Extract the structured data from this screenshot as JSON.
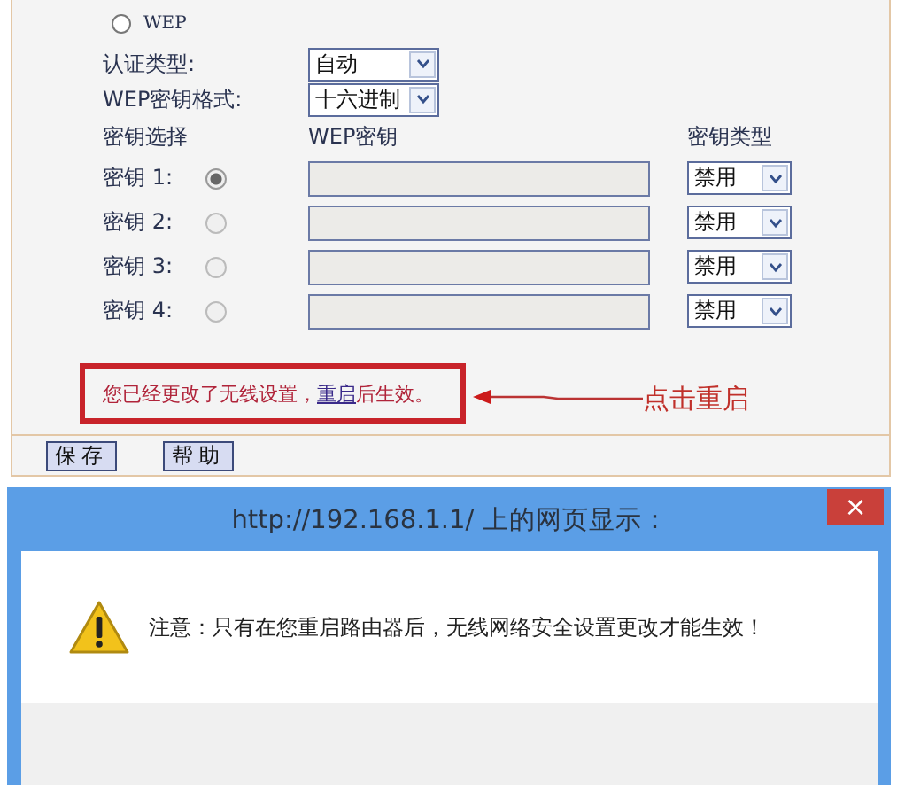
{
  "security_mode": {
    "label": "WEP",
    "selected": false
  },
  "auth_type": {
    "label": "认证类型:",
    "value": "自动"
  },
  "key_format": {
    "label": "WEP密钥格式:",
    "value": "十六进制"
  },
  "key_table": {
    "columns": [
      "密钥选择",
      "WEP密钥",
      "密钥类型"
    ],
    "rows": [
      {
        "label": "密钥 1:",
        "selected": true,
        "key_type": "禁用"
      },
      {
        "label": "密钥 2:",
        "selected": false,
        "key_type": "禁用"
      },
      {
        "label": "密钥 3:",
        "selected": false,
        "key_type": "禁用"
      },
      {
        "label": "密钥 4:",
        "selected": false,
        "key_type": "禁用"
      }
    ]
  },
  "notice": {
    "before": "您已经更改了无线设置，",
    "link": "重启",
    "after": "后生效。"
  },
  "annotation": "点击重启",
  "buttons": [
    "保存",
    "帮助"
  ],
  "dialog": {
    "title": "http://192.168.1.1/ 上的网页显示：",
    "close": "×",
    "message": "注意：只有在您重启路由器后，无线网络安全设置更改才能生效！"
  }
}
